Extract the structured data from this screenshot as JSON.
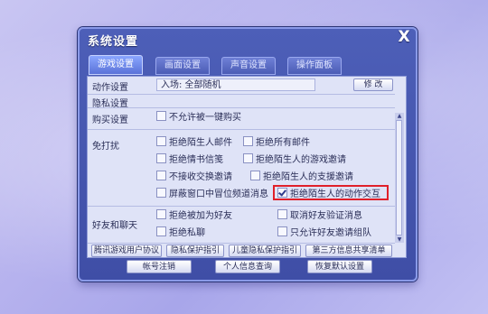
{
  "window": {
    "title": "系统设置",
    "close_label": "X"
  },
  "tabs": [
    {
      "label": "游戏设置"
    },
    {
      "label": "画面设置"
    },
    {
      "label": "声音设置"
    },
    {
      "label": "操作面板"
    }
  ],
  "action_setting": {
    "label": "动作设置",
    "value": "入场: 全部随机",
    "modify_label": "修 改"
  },
  "privacy_header": "隐私设置",
  "purchase": {
    "label": "购买设置",
    "option": "不允许被一键购买"
  },
  "disturb": {
    "label": "免打扰",
    "options": [
      {
        "text": "拒绝陌生人邮件"
      },
      {
        "text": "拒绝所有邮件"
      },
      {
        "text": "拒绝情书信笺"
      },
      {
        "text": "拒绝陌生人的游戏邀请"
      },
      {
        "text": "不接收交换邀请"
      },
      {
        "text": "拒绝陌生人的支援邀请"
      },
      {
        "text": "屏蔽窗口中冒位频道消息"
      },
      {
        "text": "拒绝陌生人的动作交互",
        "checked": true
      }
    ]
  },
  "friends": {
    "label": "好友和聊天",
    "options": [
      {
        "text": "拒绝被加为好友"
      },
      {
        "text": "取消好友验证消息"
      },
      {
        "text": "拒绝私聊"
      },
      {
        "text": "只允许好友邀请组队"
      }
    ]
  },
  "links": [
    {
      "label": "腾讯游戏用户协议"
    },
    {
      "label": "隐私保护指引"
    },
    {
      "label": "儿童隐私保护指引"
    },
    {
      "label": "第三方信息共享清单"
    }
  ],
  "bottom_buttons": [
    {
      "label": "帐号注销"
    },
    {
      "label": "个人信息查询"
    },
    {
      "label": "恢复默认设置"
    }
  ],
  "colors": {
    "accent": "#4d5fb8",
    "highlight": "#e0202a",
    "panel": "#dfe3f7"
  }
}
